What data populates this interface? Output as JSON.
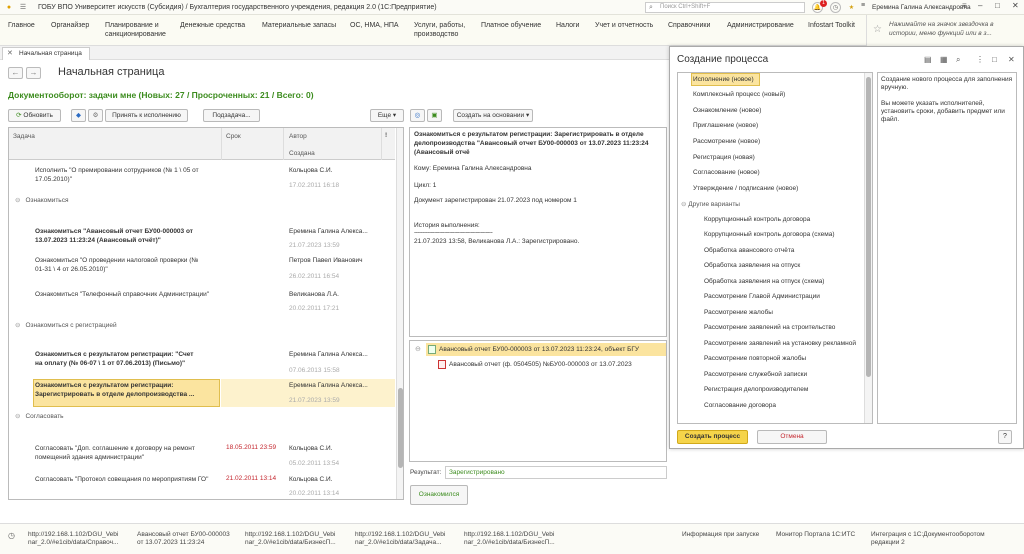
{
  "window": {
    "title": "ГОБУ ВПО Университет искусств (Субсидия) / Бухгалтерия государственного учреждения, редакция 2.0  (1С:Предприятие)",
    "search_placeholder": "Поиск Ctrl+Shift+F",
    "notification_count": "1",
    "user": "Еремина Галина Александровна"
  },
  "menu": {
    "items": [
      "Главное",
      "Органайзер",
      "Планирование и\nсанкционирование",
      "Денежные средства",
      "Материальные запасы",
      "ОС, НМА, НПА",
      "Услуги, работы,\nпроизводство",
      "Платное обучение",
      "Налоги",
      "Учет и отчетность",
      "Справочники",
      "Администрирование",
      "Infostart Toolkit"
    ],
    "hint": "Нажимайте на значок звездочка в истории, меню функций или в з..."
  },
  "tabs": {
    "home": "Начальная страница"
  },
  "page": {
    "title": "Начальная страница",
    "section_title": "Документооборот: задачи мне (Новых: 27 / Просроченных: 21 / Всего: 0)"
  },
  "toolbar": {
    "refresh": "Обновить",
    "accept": "Принять к исполнению",
    "subtask": "Подзадача...",
    "more": "Еще",
    "create_based": "Создать на основании"
  },
  "tasks": {
    "columns": {
      "task": "Задача",
      "due": "Срок",
      "author": "Автор",
      "created": "Создана",
      "flag": "!"
    },
    "rows": [
      {
        "text": "Исполнить \"О премировании сотрудников (№ 1 \\ 05 от\n17.05.2010)\"",
        "due": "",
        "author": "Кольцова С.И.",
        "date": "17.02.2011 16:18"
      },
      {
        "group": "Ознакомиться"
      },
      {
        "text": "Ознакомиться \"Авансовый отчет БУ00-000003 от\n13.07.2023 11:23:24 (Авансовый отчёт)\"",
        "due": "",
        "author": "Еремина Галина Алекса...",
        "date": "21.07.2023 13:59",
        "bold": true
      },
      {
        "text": "Ознакомиться \"О проведении налоговой проверки (№\n01-31 \\ 4 от 26.05.2010)\"",
        "due": "",
        "author": "Петров Павел Иванович",
        "date": "26.02.2011 16:54"
      },
      {
        "text": "Ознакомиться \"Телефонный справочник Администрации\"",
        "due": "",
        "author": "Великанова Л.А.",
        "date": "20.02.2011 17:21"
      },
      {
        "group": "Ознакомиться с регистрацией"
      },
      {
        "text": "Ознакомиться с результатом регистрации: \"Счет\nна оплату (№ 06-07 \\ 1 от 07.06.2013) (Письмо)\"",
        "due": "",
        "author": "Еремина Галина Алекса...",
        "date": "07.06.2013 15:58",
        "bold": true
      },
      {
        "text": "Ознакомиться с результатом регистрации:\nЗарегистрировать в отделе делопроизводства ...",
        "due": "",
        "author": "Еремина Галина Алекса...",
        "date": "21.07.2023 13:59",
        "bold": true,
        "selected": true
      },
      {
        "group": "Согласовать"
      },
      {
        "text": "Согласовать \"Доп. соглашение к договору на ремонт\nпомещений здания администрации\"",
        "due": "18.05.2011 23:59",
        "author": "Кольцова С.И.",
        "date": "05.02.2011 13:54"
      },
      {
        "text": "Согласовать \"Протокол совещания по мероприятиям ГО\"",
        "due": "21.02.2011 13:14",
        "author": "Кольцова С.И.",
        "date": "20.02.2011 13:14"
      }
    ]
  },
  "detail": {
    "heading": "Ознакомиться с результатом регистрации: Зарегистрировать в отделе делопроизводства \"Авансовый отчет БУ00-000003 от 13.07.2023 11:23:24 (Авансовый отчё",
    "to": "Кому: Еремина Галина Александровна",
    "cycle": "Цикл: 1",
    "registered": "Документ зарегистрирован 21.07.2023 под номером 1",
    "history_label": "История выполнения:",
    "history_sep": "-----------------------------------------------",
    "history_entry": "21.07.2023 13:58, Великанова Л.А.: Зарегистрировано."
  },
  "attachments": {
    "item1": "Авансовый отчет БУ00-000003 от 13.07.2023 11:23:24, объект БГУ",
    "item2": "Авансовый отчет (ф. 0504505) №БУ00-000003 от 13.07.2023"
  },
  "result": {
    "label": "Результат:",
    "value": "Зарегистрировано",
    "ack_button": "Ознакомился"
  },
  "dialog": {
    "title": "Создание процесса",
    "items": [
      "Исполнение (новое)",
      "Комплексный процесс (новый)",
      "Ознакомление (новое)",
      "Приглашение (новое)",
      "Рассмотрение (новое)",
      "Регистрация (новая)",
      "Согласование (новое)",
      "Утверждение / подписание (новое)"
    ],
    "other_group": "Другие варианты",
    "other_items": [
      "Коррупционный контроль договора",
      "Коррупционный контроль договора (схема)",
      "Обработка авансового отчёта",
      "Обработка заявления на отпуск",
      "Обработка заявления на отпуск (схема)",
      "Рассмотрение Главой Администрации",
      "Рассмотрение жалобы",
      "Рассмотрение заявлений на строительство",
      "Рассмотрение заявлений на установку рекламной",
      "Рассмотрение повторной жалобы",
      "Рассмотрение служебной записки",
      "Регистрация делопроизводителем",
      "Согласование договора"
    ],
    "description_1": "Создание нового процесса для заполнения вручную.",
    "description_2": "Вы можете указать исполнителей, установить сроки, добавить предмет или файл.",
    "create_button": "Создать процесс",
    "cancel_button": "Отмена",
    "help_button": "?"
  },
  "statusbar": {
    "items": [
      "http://192.168.1.102/DGU_Vebi\nnar_2.0/#e1cib/data/Справоч...",
      "Авансовый отчет БУ00-000003\nот 13.07.2023 11:23:24",
      "http://192.168.1.102/DGU_Vebi\nnar_2.0/#e1cib/data/БизнесП...",
      "http://192.168.1.102/DGU_Vebi\nnar_2.0/#e1cib/data/Задача...",
      "http://192.168.1.102/DGU_Vebi\nnar_2.0/#e1cib/data/БизнесП...",
      "Информация при запуске",
      "Монитор Портала 1С:ИТС",
      "Интеграция с 1С:Документооборотом\nредакции 2"
    ]
  },
  "colors": {
    "accent_green": "#3c8c1e",
    "selection": "#fbe49f",
    "primary_button": "#f5d44a",
    "overdue_red": "#c4262e"
  }
}
